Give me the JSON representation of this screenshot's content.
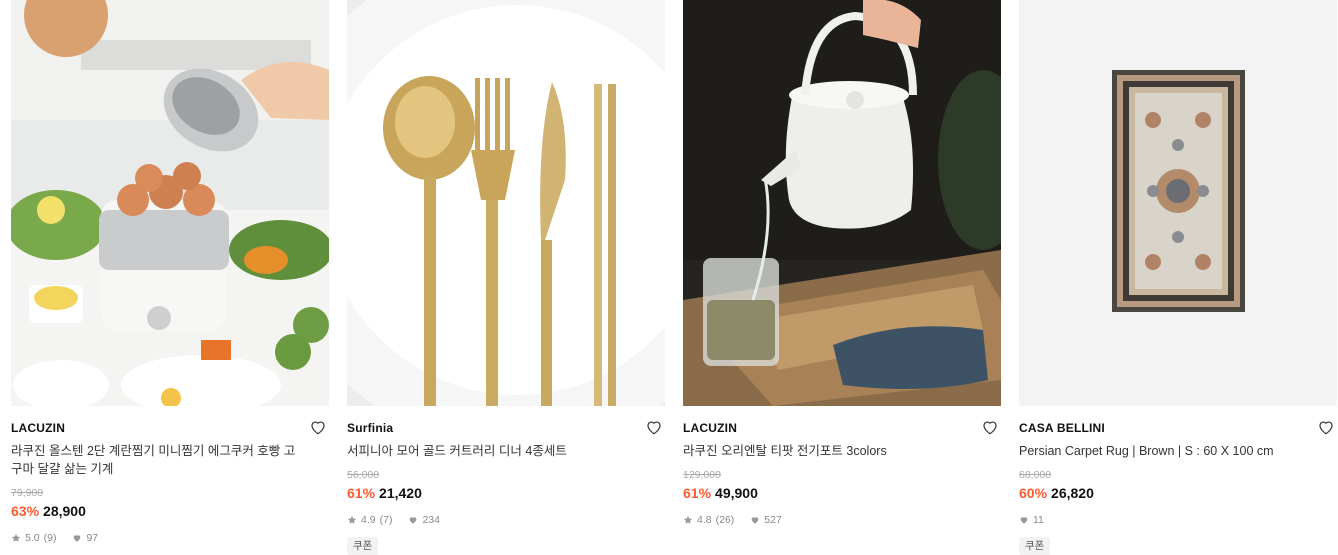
{
  "products": [
    {
      "brand": "LACUZIN",
      "title": "라쿠진 올스텐 2단 계란찜기 미니찜기 에그쿠커 호빵 고구마 달걀 삶는 기계",
      "original_price": "79,900",
      "discount": "63%",
      "price": "28,900",
      "rating": "5.0",
      "reviews": "(9)",
      "likes": "97",
      "coupon": ""
    },
    {
      "brand": "Surfinia",
      "title": "서피니아 모어 골드 커트러리 디너 4종세트",
      "original_price": "56,000",
      "discount": "61%",
      "price": "21,420",
      "rating": "4.9",
      "reviews": "(7)",
      "likes": "234",
      "coupon": "쿠폰"
    },
    {
      "brand": "LACUZIN",
      "title": "라쿠진 오리엔탈 티팟 전기포트 3colors",
      "original_price": "129,000",
      "discount": "61%",
      "price": "49,900",
      "rating": "4.8",
      "reviews": "(26)",
      "likes": "527",
      "coupon": ""
    },
    {
      "brand": "CASA BELLINI",
      "title": "Persian Carpet Rug | Brown | S : 60 X 100 cm",
      "original_price": "68,000",
      "discount": "60%",
      "price": "26,820",
      "rating": "",
      "reviews": "",
      "likes": "11",
      "coupon": "쿠폰"
    }
  ],
  "icons": {
    "like": "heart-outline-icon",
    "rating": "star-icon",
    "likes_count": "heart-filled-icon"
  },
  "colors": {
    "discount": "#ff5a2d",
    "original_price": "#aaaaaa",
    "meta": "#888888",
    "coupon_bg": "#f2f2f2"
  }
}
